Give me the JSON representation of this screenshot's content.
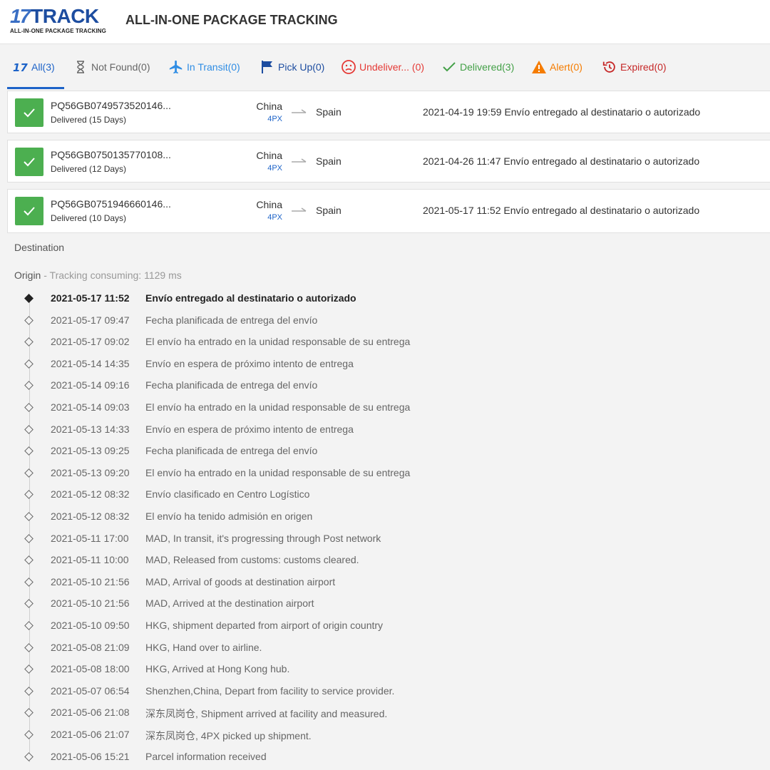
{
  "header": {
    "logo_mark": "17",
    "logo_word": "TRACK",
    "logo_tagline": "ALL-IN-ONE PACKAGE TRACKING",
    "title": "ALL-IN-ONE PACKAGE TRACKING"
  },
  "tabs": [
    {
      "label": "All(3)",
      "icon": "17track-logo-icon",
      "color": "#1d63c8"
    },
    {
      "label": "Not Found(0)",
      "icon": "hourglass-icon",
      "color": "#666666"
    },
    {
      "label": "In Transit(0)",
      "icon": "airplane-icon",
      "color": "#2f8de4"
    },
    {
      "label": "Pick Up(0)",
      "icon": "flag-icon",
      "color": "#1d4da0"
    },
    {
      "label": "Undeliver... (0)",
      "icon": "sad-face-icon",
      "color": "#e53935"
    },
    {
      "label": "Delivered(3)",
      "icon": "checkmark-icon",
      "color": "#43a047"
    },
    {
      "label": "Alert(0)",
      "icon": "warning-icon",
      "color": "#f57c00"
    },
    {
      "label": "Expired(0)",
      "icon": "history-icon",
      "color": "#c62828"
    }
  ],
  "packages": [
    {
      "id": "PQ56GB0749573520146...",
      "status": "Delivered (15 Days)",
      "origin": "China",
      "carrier": "4PX",
      "destination": "Spain",
      "last_time": "2021-04-19 19:59",
      "last_event": "Envío entregado al destinatario o autorizado"
    },
    {
      "id": "PQ56GB0750135770108...",
      "status": "Delivered (12 Days)",
      "origin": "China",
      "carrier": "4PX",
      "destination": "Spain",
      "last_time": "2021-04-26 11:47",
      "last_event": "Envío entregado al destinatario o autorizado"
    },
    {
      "id": "PQ56GB0751946660146...",
      "status": "Delivered (10 Days)",
      "origin": "China",
      "carrier": "4PX",
      "destination": "Spain",
      "last_time": "2021-05-17 11:52",
      "last_event": "Envío entregado al destinatario o autorizado"
    }
  ],
  "detail": {
    "destination_label": "Destination",
    "origin_label": "Origin",
    "origin_meta": " - Tracking consuming: 1129 ms",
    "events": [
      {
        "time": "2021-05-17 11:52",
        "text": "Envío entregado al destinatario o autorizado"
      },
      {
        "time": "2021-05-17 09:47",
        "text": "Fecha planificada de entrega del envío"
      },
      {
        "time": "2021-05-17 09:02",
        "text": "El envío ha entrado en la unidad responsable de su entrega"
      },
      {
        "time": "2021-05-14 14:35",
        "text": "Envío en espera de próximo intento de entrega"
      },
      {
        "time": "2021-05-14 09:16",
        "text": "Fecha planificada de entrega del envío"
      },
      {
        "time": "2021-05-14 09:03",
        "text": "El envío ha entrado en la unidad responsable de su entrega"
      },
      {
        "time": "2021-05-13 14:33",
        "text": "Envío en espera de próximo intento de entrega"
      },
      {
        "time": "2021-05-13 09:25",
        "text": "Fecha planificada de entrega del envío"
      },
      {
        "time": "2021-05-13 09:20",
        "text": "El envío ha entrado en la unidad responsable de su entrega"
      },
      {
        "time": "2021-05-12 08:32",
        "text": "Envío clasificado en Centro Logístico"
      },
      {
        "time": "2021-05-12 08:32",
        "text": "El envío ha tenido admisión en origen"
      },
      {
        "time": "2021-05-11 17:00",
        "text": "MAD, In transit, it's progressing through Post network"
      },
      {
        "time": "2021-05-11 10:00",
        "text": "MAD, Released from customs: customs cleared."
      },
      {
        "time": "2021-05-10 21:56",
        "text": "MAD, Arrival of goods at destination airport"
      },
      {
        "time": "2021-05-10 21:56",
        "text": "MAD, Arrived at the destination airport"
      },
      {
        "time": "2021-05-10 09:50",
        "text": "HKG, shipment departed from airport of origin country"
      },
      {
        "time": "2021-05-08 21:09",
        "text": "HKG, Hand over to airline."
      },
      {
        "time": "2021-05-08 18:00",
        "text": "HKG, Arrived at Hong Kong hub."
      },
      {
        "time": "2021-05-07 06:54",
        "text": "Shenzhen,China, Depart from facility to service provider."
      },
      {
        "time": "2021-05-06 21:08",
        "text": "深东凤岗仓, Shipment arrived at facility and measured."
      },
      {
        "time": "2021-05-06 21:07",
        "text": "深东凤岗仓, 4PX picked up shipment."
      },
      {
        "time": "2021-05-06 15:21",
        "text": "Parcel information received"
      }
    ]
  }
}
